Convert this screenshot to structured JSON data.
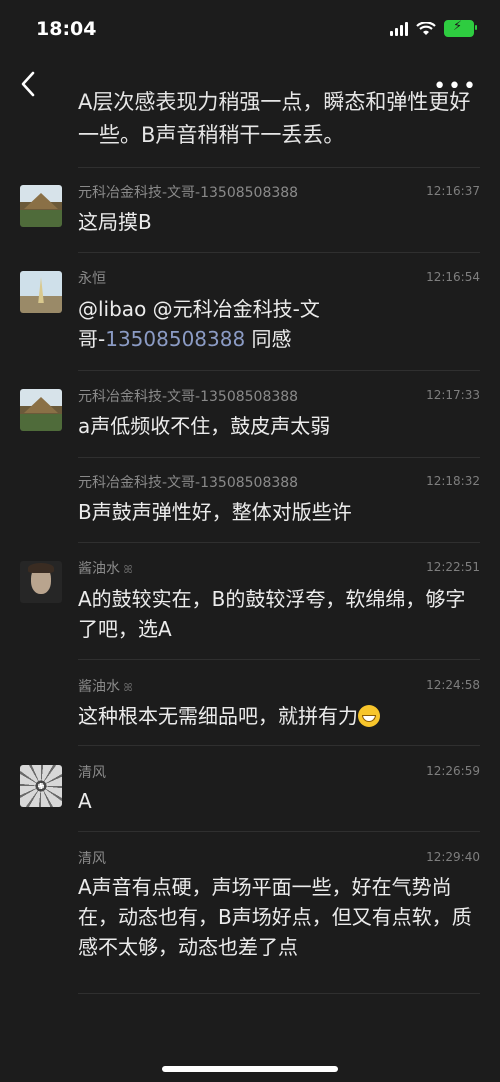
{
  "status": {
    "time": "18:04"
  },
  "top_message": "A层次感表现力稍强一点，瞬态和弹性更好一些。B声音稍稍干一丢丢。",
  "messages": [
    {
      "name": "元科冶金科技-文哥-13508508388",
      "time": "12:16:37",
      "text": "这局摸B"
    },
    {
      "name": "永恒",
      "time": "12:16:54",
      "text_pre": "@libao @元科冶金科技-文哥-",
      "phone": "13508508388",
      "text_post": " 同感"
    },
    {
      "name": "元科冶金科技-文哥-13508508388",
      "time": "12:17:33",
      "text": "a声低频收不住，鼓皮声太弱"
    },
    {
      "name": "元科冶金科技-文哥-13508508388",
      "time": "12:18:32",
      "text": "B声鼓声弹性好，整体对版些许"
    },
    {
      "name": "酱油水",
      "time": "12:22:51",
      "text": "A的鼓较实在，B的鼓较浮夸，软绵绵，够字了吧，选A"
    },
    {
      "name": "酱油水",
      "time": "12:24:58",
      "text": "这种根本无需细品吧，就拼有力"
    },
    {
      "name": "清风",
      "time": "12:26:59",
      "text": "A"
    },
    {
      "name": "清风",
      "time": "12:29:40",
      "text": "A声音有点硬，声场平面一些，好在气势尚在，动态也有，B声场好点，但又有点软，质感不太够，动态也差了点"
    }
  ]
}
